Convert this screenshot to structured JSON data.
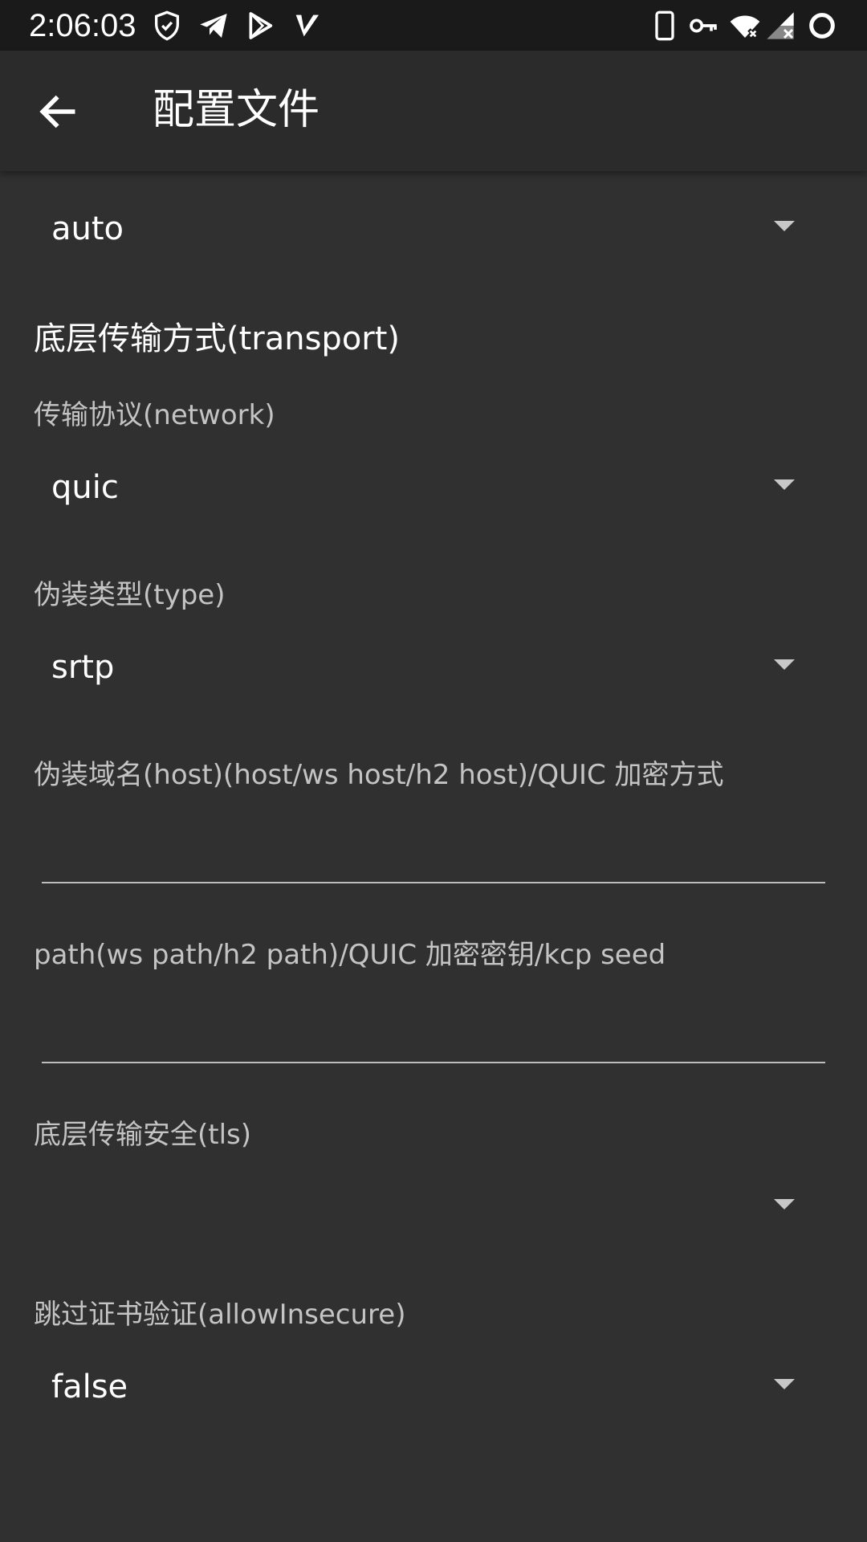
{
  "status_bar": {
    "time": "2:06:03",
    "left_icons": [
      "shield-check-icon",
      "telegram-icon",
      "play-store-icon",
      "v-app-icon"
    ],
    "right_icons": [
      "phone-icon",
      "vpn-key-icon",
      "wifi-off-icon",
      "signal-off-icon",
      "circle-icon"
    ]
  },
  "toolbar": {
    "title": "配置文件",
    "back_icon": "arrow-back-icon"
  },
  "form": {
    "security_value": "auto",
    "transport_section": "底层传输方式(transport)",
    "network_label": "传输协议(network)",
    "network_value": "quic",
    "type_label": "伪装类型(type)",
    "type_value": "srtp",
    "host_label": "伪装域名(host)(host/ws host/h2 host)/QUIC 加密方式",
    "host_value": "",
    "path_label": "path(ws path/h2 path)/QUIC 加密密钥/kcp seed",
    "path_value": "",
    "tls_label": "底层传输安全(tls)",
    "tls_value": "",
    "allow_insecure_label": "跳过证书验证(allowInsecure)",
    "allow_insecure_value": "false"
  },
  "colors": {
    "background": "#303030",
    "toolbar": "#2b2b2b",
    "status_bar": "#1a1a1a",
    "label_text": "#c4c4c4",
    "underline": "#bdbdbd"
  }
}
